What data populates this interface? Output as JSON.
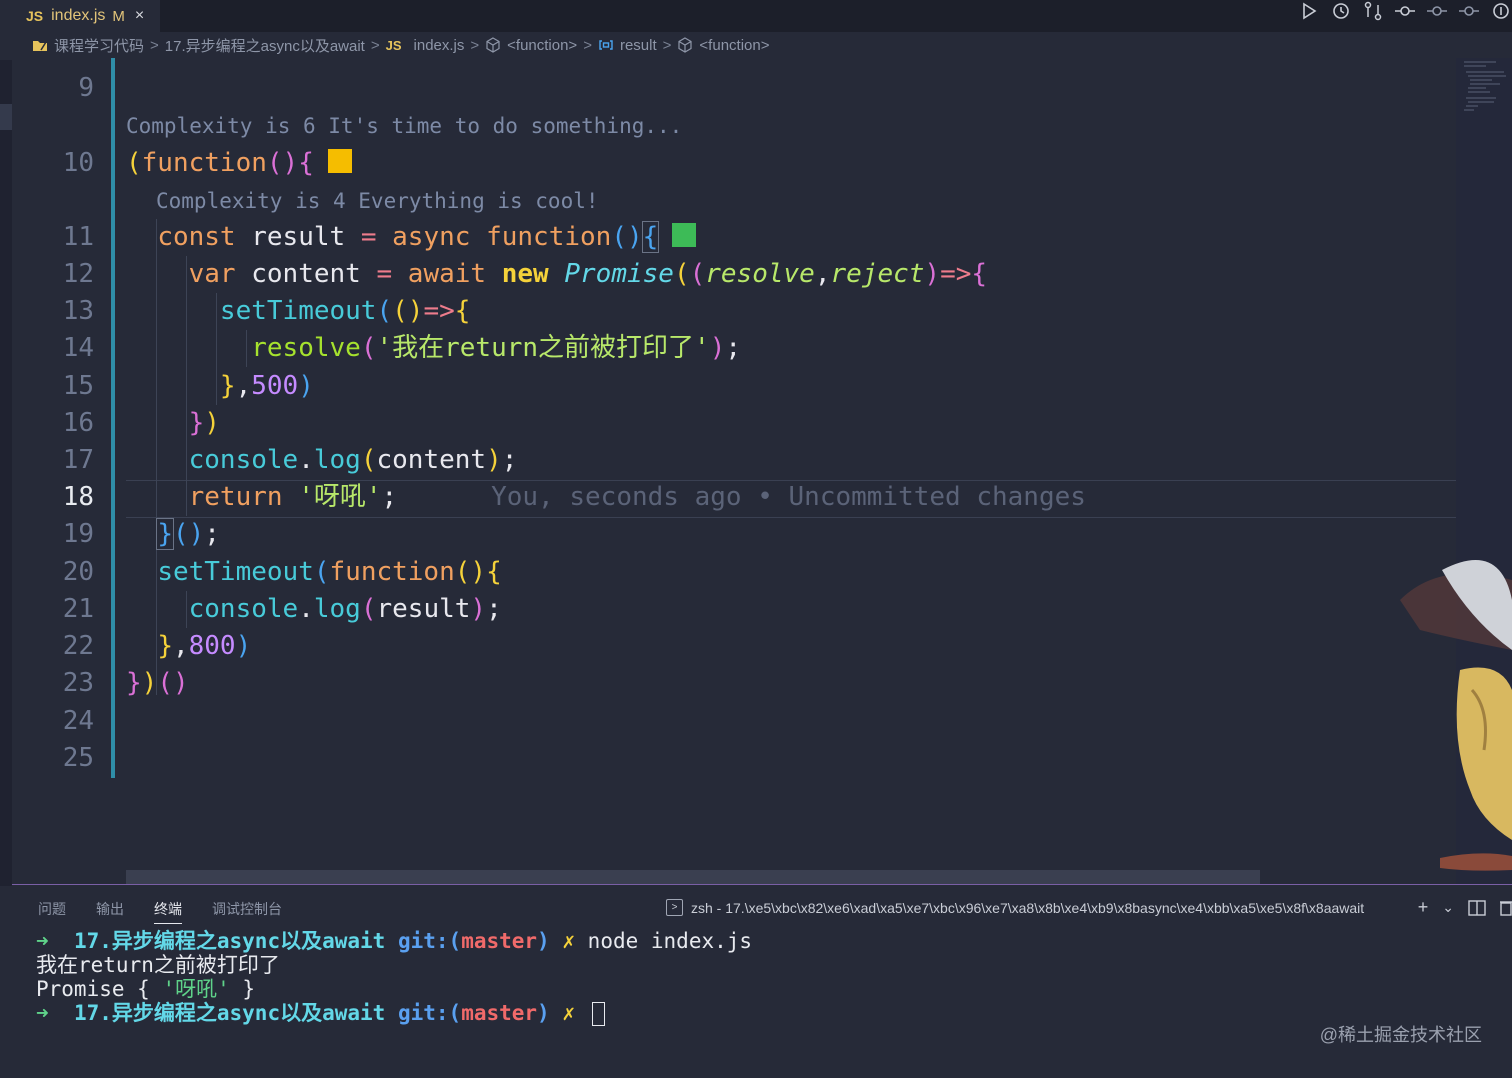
{
  "tab": {
    "badge": "JS",
    "name": "index.js",
    "modified": "M",
    "close": "×"
  },
  "breadcrumb": [
    {
      "label": "课程学习代码",
      "icon": "folder-icon"
    },
    {
      "label": "17.异步编程之async以及await",
      "icon": ""
    },
    {
      "label": "index.js",
      "icon": "js-file-icon",
      "badge": "JS"
    },
    {
      "label": "<function>",
      "icon": "cube-icon"
    },
    {
      "label": "result",
      "icon": "variable-icon"
    },
    {
      "label": "<function>",
      "icon": "cube-icon"
    }
  ],
  "breadcrumb_sep": ">",
  "editor": {
    "line_numbers": [
      "9",
      "10",
      "11",
      "12",
      "13",
      "14",
      "15",
      "16",
      "17",
      "18",
      "19",
      "20",
      "21",
      "22",
      "23",
      "24",
      "25"
    ],
    "active_line": "18",
    "codelens_1": "Complexity is 6 It's time to do something...",
    "codelens_2": "Complexity is 4 Everything is cool!",
    "blame": "You, seconds ago • Uncommitted changes",
    "complexity_colors": {
      "outer": "#f5bd00",
      "inner": "#3dbb57"
    }
  },
  "code": {
    "l10": {
      "open": "(",
      "kw": "function",
      "parens": "()",
      "brace": "{"
    },
    "l11": {
      "const": "const",
      "name": "result",
      "eq": "=",
      "async": "async",
      "fn": "function",
      "parens": "()",
      "brace": "{"
    },
    "l12": {
      "var": "var",
      "name": "content",
      "eq": "=",
      "await": "await",
      "new": "new",
      "cls": "Promise",
      "open": "(",
      "p_open": "(",
      "arg1": "resolve",
      "comma": ",",
      "arg2": "reject",
      "p_close": ")",
      "arrow": "=>",
      "brace": "{"
    },
    "l13": {
      "fn": "setTimeout",
      "open": "(",
      "parens": "()",
      "arrow": "=>",
      "brace": "{"
    },
    "l14": {
      "fn": "resolve",
      "open": "(",
      "str": "'我在return之前被打印了'",
      "close": ")",
      "semi": ";"
    },
    "l15": {
      "brace": "}",
      "comma": ",",
      "num": "500",
      "close": ")"
    },
    "l16": {
      "brace": "}",
      "close": ")"
    },
    "l17": {
      "obj": "console",
      "dot": ".",
      "method": "log",
      "open": "(",
      "arg": "content",
      "close": ")",
      "semi": ";"
    },
    "l18": {
      "kw": "return",
      "str": "'呀吼'",
      "semi": ";"
    },
    "l19": {
      "brace": "}",
      "parens": "()",
      "semi": ";"
    },
    "l20": {
      "fn": "setTimeout",
      "open": "(",
      "kw": "function",
      "parens": "()",
      "brace": "{"
    },
    "l21": {
      "obj": "console",
      "dot": ".",
      "method": "log",
      "open": "(",
      "arg": "result",
      "close": ")",
      "semi": ";"
    },
    "l22": {
      "brace": "}",
      "comma": ",",
      "num": "800",
      "close": ")"
    },
    "l23": {
      "brace": "}",
      "close": ")",
      "parens": "()"
    }
  },
  "panel": {
    "tabs": [
      "问题",
      "输出",
      "终端",
      "调试控制台"
    ],
    "active_tab": "终端",
    "terminal_title": "zsh - 17.\\xe5\\xbc\\x82\\xe6\\xad\\xa5\\xe7\\xbc\\x96\\xe7\\xa8\\x8b\\xe4\\xb9\\x8basync\\xe4\\xbb\\xa5\\xe5\\x8f\\x8aawait",
    "add": "+",
    "dropdown": "⌄"
  },
  "terminal": {
    "arrow": "➜",
    "dir": "17.异步编程之async以及await",
    "git": "git:(",
    "branch": "master",
    "git_close": ")",
    "dirty": "✗",
    "command": "node index.js",
    "output_1": "我在return之前被打印了",
    "output_2_pre": "Promise { ",
    "output_2_str": "'呀吼'",
    "output_2_post": " }"
  },
  "watermark": "@稀土掘金技术社区"
}
